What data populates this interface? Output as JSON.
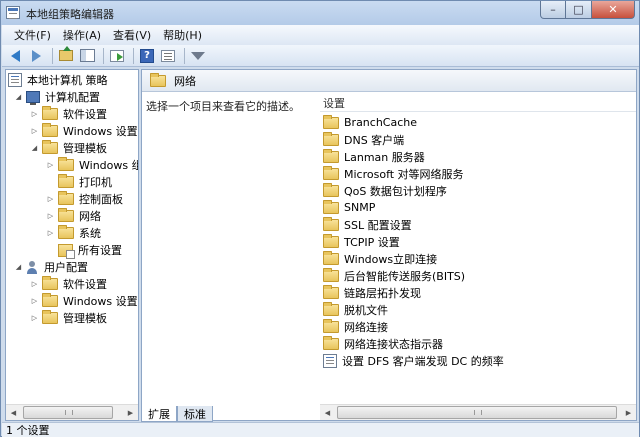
{
  "window": {
    "title": "本地组策略编辑器"
  },
  "menu": [
    "文件(F)",
    "操作(A)",
    "查看(V)",
    "帮助(H)"
  ],
  "tree": {
    "root": "本地计算机 策略",
    "computer": "计算机配置",
    "computer_children": [
      "软件设置",
      "Windows 设置",
      "管理模板"
    ],
    "admin_children": [
      "Windows 组",
      "打印机",
      "控制面板",
      "网络",
      "系统",
      "所有设置"
    ],
    "user": "用户配置",
    "user_children": [
      "软件设置",
      "Windows 设置",
      "管理模板"
    ]
  },
  "right": {
    "header": "网络",
    "description": "选择一个项目来查看它的描述。",
    "column": "设置",
    "items": [
      "BranchCache",
      "DNS 客户端",
      "Lanman 服务器",
      "Microsoft 对等网络服务",
      "QoS 数据包计划程序",
      "SNMP",
      "SSL 配置设置",
      "TCPIP 设置",
      "Windows立即连接",
      "后台智能传送服务(BITS)",
      "链路层拓扑发现",
      "脱机文件",
      "网络连接",
      "网络连接状态指示器"
    ],
    "policy_item": "设置 DFS 客户端发现 DC 的频率"
  },
  "tabs": [
    "扩展",
    "标准"
  ],
  "status": "1 个设置",
  "icons": [
    "back-arrow-icon",
    "forward-arrow-icon",
    "up-folder-icon",
    "show-tree-icon",
    "export-icon",
    "help-icon",
    "properties-icon",
    "filter-icon"
  ]
}
